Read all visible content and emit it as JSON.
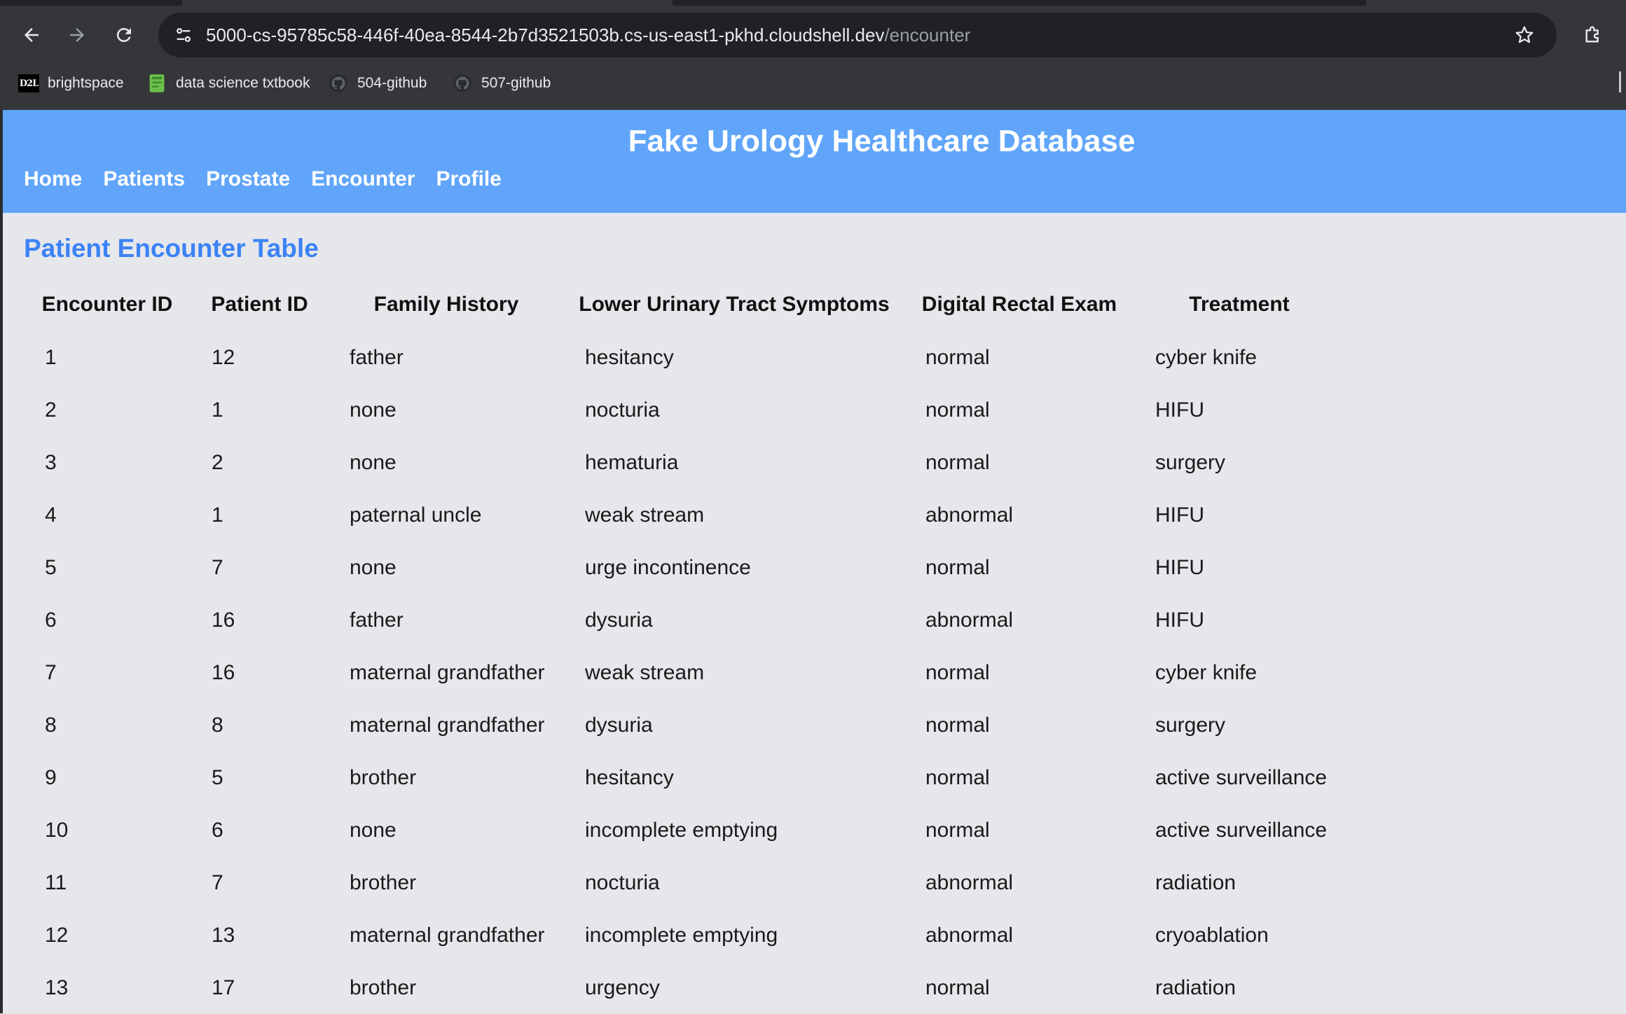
{
  "browser": {
    "url_host": "5000-cs-95785c58-446f-40ea-8544-2b7d3521503b.cs-us-east1-pkhd.cloudshell.dev",
    "url_path": "/encounter",
    "bookmarks": [
      {
        "label": "brightspace",
        "icon": "d2l-icon",
        "icon_text": "D2L"
      },
      {
        "label": "data science txtbook",
        "icon": "book-icon"
      },
      {
        "label": "504-github",
        "icon": "github-icon"
      },
      {
        "label": "507-github",
        "icon": "github-icon"
      }
    ]
  },
  "site": {
    "title": "Fake Urology Healthcare Database",
    "nav": [
      "Home",
      "Patients",
      "Prostate",
      "Encounter",
      "Profile"
    ],
    "header_color": "#60a5fa"
  },
  "encounters": {
    "title": "Patient Encounter Table",
    "columns": [
      "Encounter ID",
      "Patient ID",
      "Family History",
      "Lower Urinary Tract Symptoms",
      "Digital Rectal Exam",
      "Treatment"
    ],
    "rows": [
      [
        "1",
        "12",
        "father",
        "hesitancy",
        "normal",
        "cyber knife"
      ],
      [
        "2",
        "1",
        "none",
        "nocturia",
        "normal",
        "HIFU"
      ],
      [
        "3",
        "2",
        "none",
        "hematuria",
        "normal",
        "surgery"
      ],
      [
        "4",
        "1",
        "paternal uncle",
        "weak stream",
        "abnormal",
        "HIFU"
      ],
      [
        "5",
        "7",
        "none",
        "urge incontinence",
        "normal",
        "HIFU"
      ],
      [
        "6",
        "16",
        "father",
        "dysuria",
        "abnormal",
        "HIFU"
      ],
      [
        "7",
        "16",
        "maternal grandfather",
        "weak stream",
        "normal",
        "cyber knife"
      ],
      [
        "8",
        "8",
        "maternal grandfather",
        "dysuria",
        "normal",
        "surgery"
      ],
      [
        "9",
        "5",
        "brother",
        "hesitancy",
        "normal",
        "active surveillance"
      ],
      [
        "10",
        "6",
        "none",
        "incomplete emptying",
        "normal",
        "active surveillance"
      ],
      [
        "11",
        "7",
        "brother",
        "nocturia",
        "abnormal",
        "radiation"
      ],
      [
        "12",
        "13",
        "maternal grandfather",
        "incomplete emptying",
        "abnormal",
        "cryoablation"
      ],
      [
        "13",
        "17",
        "brother",
        "urgency",
        "normal",
        "radiation"
      ]
    ]
  }
}
